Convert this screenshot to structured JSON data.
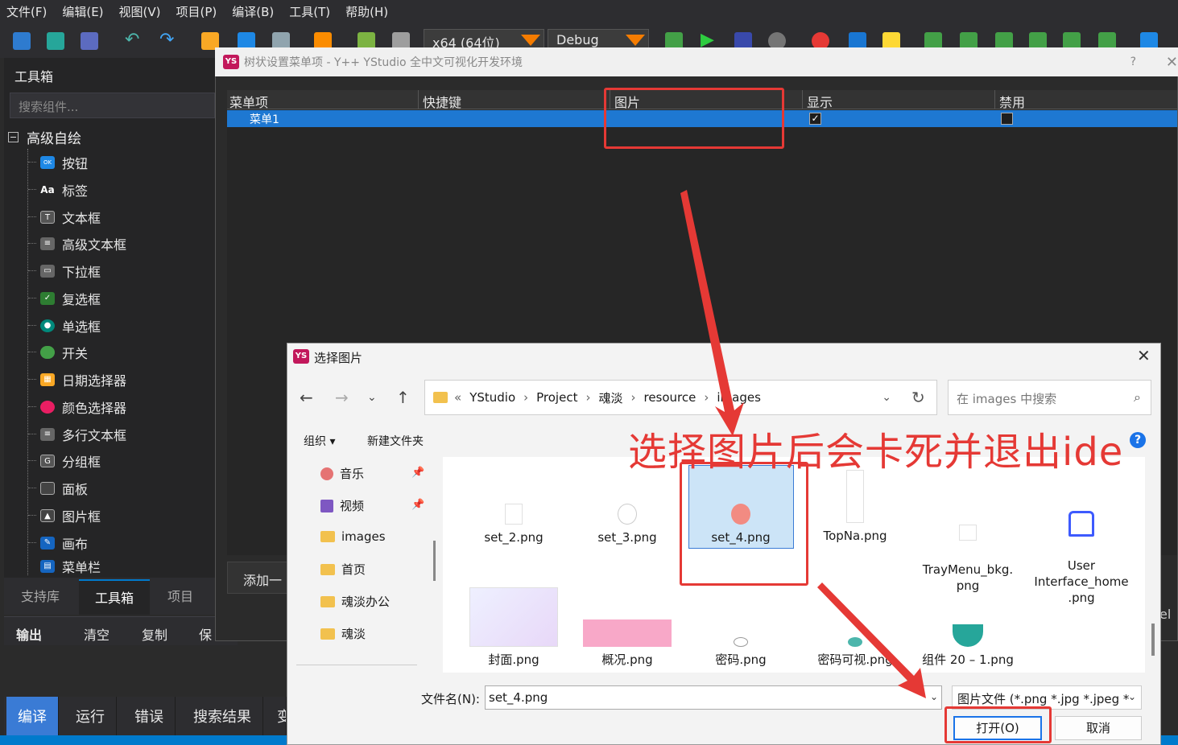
{
  "menubar": [
    "文件(F)",
    "编辑(E)",
    "视图(V)",
    "项目(P)",
    "编译(B)",
    "工具(T)",
    "帮助(H)"
  ],
  "toolbar": {
    "platform": "x64 (64位)",
    "config": "Debug"
  },
  "toolbox": {
    "title": "工具箱",
    "search_placeholder": "搜索组件...",
    "group": "高级自绘",
    "items": [
      "按钮",
      "标签",
      "文本框",
      "高级文本框",
      "下拉框",
      "复选框",
      "单选框",
      "开关",
      "日期选择器",
      "颜色选择器",
      "多行文本框",
      "分组框",
      "面板",
      "图片框",
      "画布",
      "菜单栏"
    ],
    "tabs": [
      "支持库",
      "工具箱",
      "项目"
    ]
  },
  "output": {
    "title": "输出",
    "clear": "清空",
    "copy": "复制",
    "save": "保"
  },
  "bottom_tabs": [
    "编译",
    "运行",
    "错误",
    "搜索结果",
    "变"
  ],
  "menu_dialog": {
    "title": "树状设置菜单项 - Y++ YStudio 全中文可视化开发环境",
    "help": "?",
    "columns": [
      "菜单项",
      "快捷键",
      "图片",
      "显示",
      "禁用"
    ],
    "row": {
      "name": "菜单1",
      "show_checked": "✓"
    },
    "add_button": "添加一",
    "right_clip": "el"
  },
  "file_dialog": {
    "title": "选择图片",
    "close": "✕",
    "path": [
      "YStudio",
      "Project",
      "魂淡",
      "resource",
      "images"
    ],
    "path_prefix": "«",
    "search_placeholder": "在 images 中搜索",
    "organize": "组织 ▾",
    "new_folder": "新建文件夹",
    "nav": [
      "音乐",
      "视频",
      "images",
      "首页",
      "魂淡办公",
      "魂淡"
    ],
    "files_row1": [
      "set_2.png",
      "set_3.png",
      "set_4.png",
      "TopNa.png",
      "TrayMenu_bkg.\npng",
      "User\nInterface_home\n.png"
    ],
    "files_row2": [
      "封面.png",
      "概况.png",
      "密码.png",
      "密码可视.png",
      "组件 20 – 1.png"
    ],
    "filename_label": "文件名(N):",
    "filename_value": "set_4.png",
    "filter": "图片文件 (*.png *.jpg *.jpeg *",
    "open": "打开(O)",
    "cancel": "取消"
  },
  "annotation": "选择图片后会卡死并退出ide",
  "colors": {
    "accent": "#1e78d2",
    "annotation_red": "#e53935",
    "statusbar": "#007acc"
  }
}
